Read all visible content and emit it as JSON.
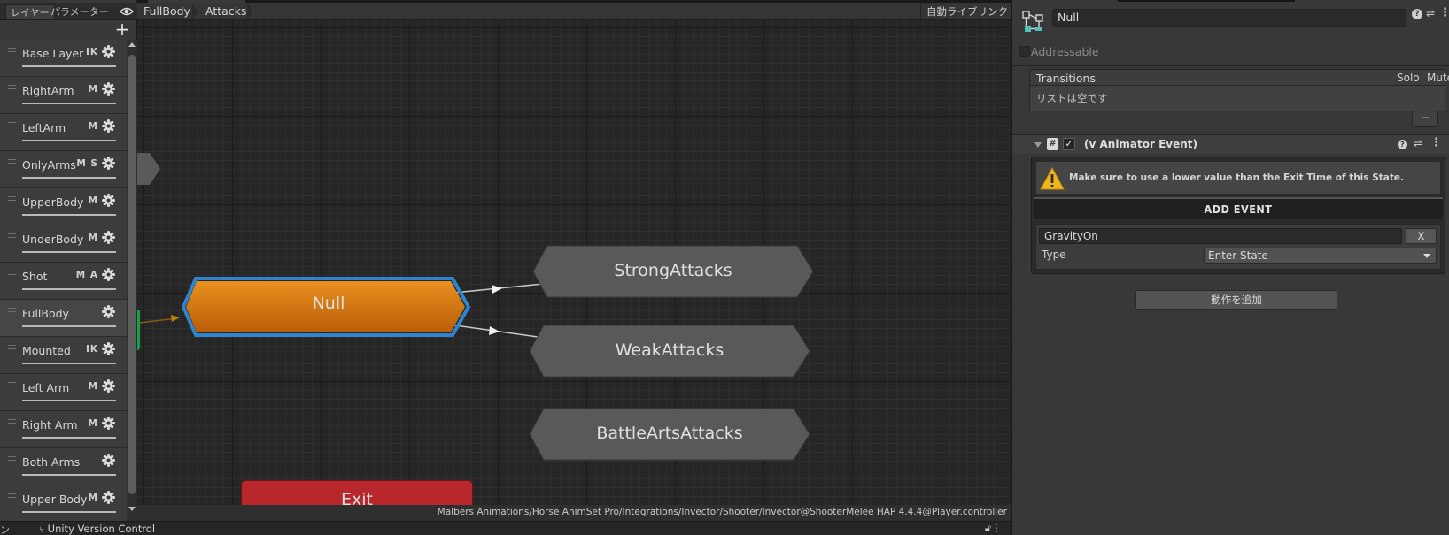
{
  "layer_panel": {
    "tabs": [
      "レイヤー",
      "パラメーター"
    ],
    "eye_icon": "eye-icon",
    "add_icon": "+",
    "layers": [
      {
        "name": "Base Layer",
        "flags": "IK"
      },
      {
        "name": "RightArm",
        "flags": "M"
      },
      {
        "name": "LeftArm",
        "flags": "M"
      },
      {
        "name": "OnlyArms",
        "flags": "M S"
      },
      {
        "name": "UpperBody",
        "flags": "M"
      },
      {
        "name": "UnderBody",
        "flags": "M"
      },
      {
        "name": "Shot",
        "flags": "M A"
      },
      {
        "name": "FullBody",
        "flags": "",
        "selected": true
      },
      {
        "name": "Mounted",
        "flags": "IK"
      },
      {
        "name": "Left Arm",
        "flags": "M"
      },
      {
        "name": "Right Arm",
        "flags": "M"
      },
      {
        "name": "Both Arms",
        "flags": ""
      },
      {
        "name": "Upper Body",
        "flags": "M"
      }
    ]
  },
  "breadcrumb": {
    "items": [
      "FullBody",
      "Attacks"
    ],
    "auto_live_link": "自動ライブリンク"
  },
  "graph": {
    "states": [
      {
        "name": "Null",
        "kind": "selected-default",
        "color": "#d4720c"
      },
      {
        "name": "StrongAttacks",
        "kind": "normal",
        "color": "#5a5a5a"
      },
      {
        "name": "WeakAttacks",
        "kind": "normal",
        "color": "#5a5a5a"
      },
      {
        "name": "BattleArtsAttacks",
        "kind": "normal",
        "color": "#5a5a5a"
      },
      {
        "name": "Exit",
        "kind": "exit",
        "color": "#b8272b"
      }
    ],
    "controller_path": "Malbers Animations/Horse AnimSet Pro/Integrations/Invector/Shooter/Invector@ShooterMelee HAP 4.4.4@Player.controller"
  },
  "status_bar": {
    "left_text": "ン",
    "version_control": "Unity Version Control",
    "lock_icon": "lock-icon",
    "menu_icon": "⋮"
  },
  "inspector": {
    "state_icon": "state-node-icon",
    "state_name": "Null",
    "addressable_label": "Addressable",
    "transitions": {
      "title": "Transitions",
      "solo": "Solo",
      "mute": "Mute",
      "empty_text": "リストは空です",
      "remove_label": "−"
    },
    "component": {
      "title": "(v Animator Event)",
      "script_icon": "#",
      "enabled_check": "✓",
      "warning": "Make sure to use a lower value than the Exit Time of this State.",
      "add_event_label": "ADD EVENT",
      "event_name": "GravityOn",
      "event_remove": "X",
      "type_label": "Type",
      "type_value": "Enter State"
    },
    "add_behaviour_label": "動作を追加"
  }
}
